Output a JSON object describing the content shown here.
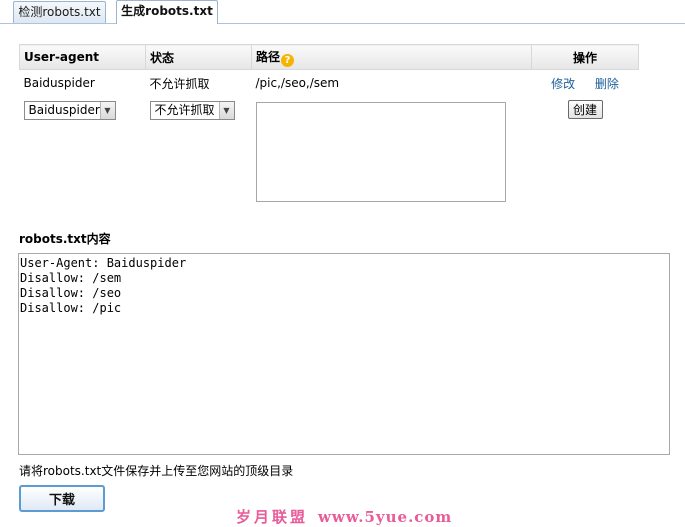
{
  "tabs": [
    {
      "label": "检测robots.txt",
      "active": false
    },
    {
      "label": "生成robots.txt",
      "active": true
    }
  ],
  "rules_table": {
    "headers": {
      "user_agent": "User-agent",
      "status": "状态",
      "path": "路径",
      "actions": "操作"
    },
    "rows": [
      {
        "user_agent": "Baiduspider",
        "status": "不允许抓取",
        "path": "/pic,/seo,/sem",
        "edit_label": "修改",
        "delete_label": "删除"
      }
    ],
    "new_rule": {
      "user_agent_selected": "Baiduspider",
      "status_selected": "不允许抓取",
      "path_value": "",
      "create_label": "创建"
    }
  },
  "content": {
    "title": "robots.txt内容",
    "text": "User-Agent: Baiduspider\nDisallow: /sem\nDisallow: /seo\nDisallow: /pic"
  },
  "note": "请将robots.txt文件保存并上传至您网站的顶级目录",
  "download_label": "下载",
  "watermark": {
    "brand": "岁月联盟",
    "url": "www.5yue.com"
  },
  "icons": {
    "help": "help-circle-icon"
  },
  "colors": {
    "link": "#1d5f9a",
    "help_icon": "#f5b400",
    "download_border": "#5d9bd3",
    "watermark": "#e85c9a"
  }
}
